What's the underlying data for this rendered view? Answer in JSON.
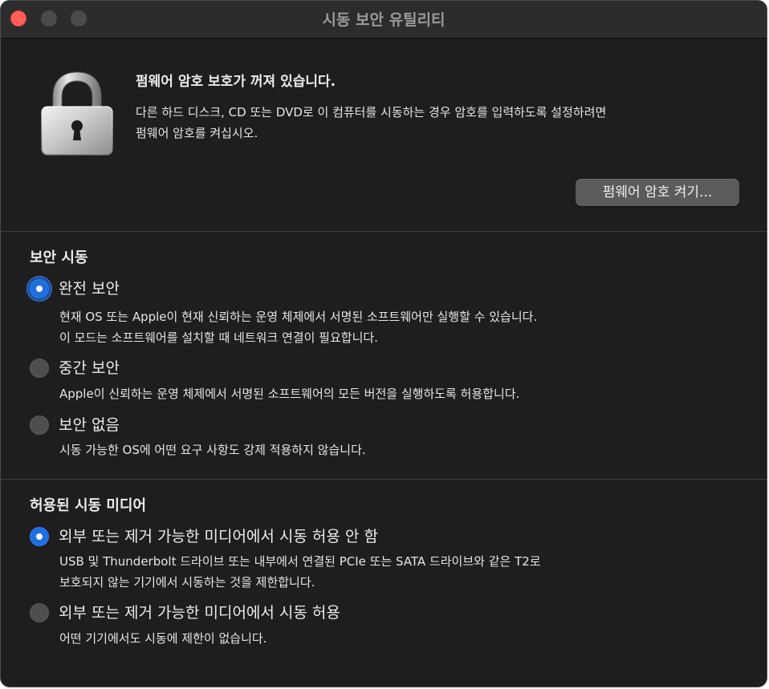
{
  "window": {
    "title": "시동 보안 유틸리티"
  },
  "firmware": {
    "icon": "padlock-icon",
    "heading": "펌웨어 암호 보호가 꺼져 있습니다.",
    "description_line1": "다른 하드 디스크, CD 또는 DVD로 이 컴퓨터를 시동하는 경우 암호를 입력하도록 설정하려면",
    "description_line2": "펌웨어 암호를 켜십시오.",
    "button_label": "펌웨어 암호 켜기..."
  },
  "secure_boot": {
    "title": "보안 시동",
    "options": [
      {
        "label": "완전 보안",
        "selected": true,
        "desc_line1": "현재 OS 또는 Apple이 현재 신뢰하는 운영 체제에서 서명된 소프트웨어만 실행할 수 있습니다.",
        "desc_line2": "이 모드는 소프트웨어를 설치할 때 네트워크 연결이 필요합니다."
      },
      {
        "label": "중간 보안",
        "selected": false,
        "desc_line1": "Apple이 신뢰하는 운영 체제에서 서명된 소프트웨어의 모든 버전을 실행하도록 허용합니다."
      },
      {
        "label": "보안 없음",
        "selected": false,
        "desc_line1": "시동 가능한 OS에 어떤 요구 사항도 강제 적용하지 않습니다."
      }
    ]
  },
  "boot_media": {
    "title": "허용된 시동 미디어",
    "options": [
      {
        "label": "외부 또는 제거 가능한 미디어에서 시동 허용 안 함",
        "selected": true,
        "desc_line1": "USB 및 Thunderbolt 드라이브 또는 내부에서 연결된 PCIe 또는 SATA 드라이브와 같은 T2로",
        "desc_line2": "보호되지 않는 기기에서 시동하는 것을 제한합니다."
      },
      {
        "label": "외부 또는 제거 가능한 미디어에서 시동 허용",
        "selected": false,
        "desc_line1": "어떤 기기에서도 시동에 제한이 없습니다."
      }
    ]
  },
  "colors": {
    "accent": "#1f6fe0",
    "window_bg": "#1e1e1e",
    "close_button": "#ff5f57"
  }
}
